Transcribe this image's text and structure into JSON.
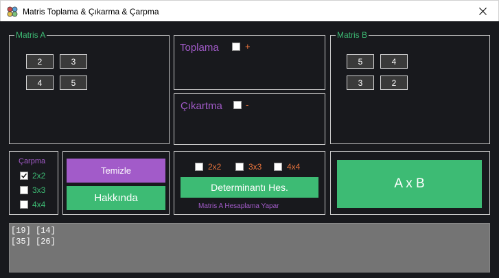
{
  "window": {
    "title": "Matris Toplama & Çıkarma & Çarpma",
    "icon": "app-icon",
    "close_icon": "close-icon"
  },
  "matrix_a": {
    "legend": "Matris A",
    "cells": [
      "2",
      "3",
      "4",
      "5"
    ]
  },
  "matrix_b": {
    "legend": "Matris B",
    "cells": [
      "5",
      "4",
      "3",
      "2"
    ]
  },
  "toplama": {
    "label": "Toplama",
    "sign": "+",
    "checked": false
  },
  "cikartma": {
    "label": "Çıkartma",
    "sign": "-",
    "checked": false
  },
  "carpma": {
    "title": "Çarpma",
    "options": [
      {
        "label": "2x2",
        "checked": true
      },
      {
        "label": "3x3",
        "checked": false
      },
      {
        "label": "4x4",
        "checked": false
      }
    ]
  },
  "buttons": {
    "temizle": "Temizle",
    "hakkinda": "Hakkında",
    "determinant": "Determinantı Hes.",
    "multiply": "A x B"
  },
  "determinant": {
    "options": [
      {
        "label": "2x2",
        "checked": false
      },
      {
        "label": "3x3",
        "checked": false
      },
      {
        "label": "4x4",
        "checked": false
      }
    ],
    "note": "Matris A Hesaplama Yapar"
  },
  "output": {
    "lines": [
      "[19] [14]",
      "[35] [26]"
    ]
  },
  "colors": {
    "background": "#18191d",
    "green": "#3dbb74",
    "purple": "#a25bc9",
    "orange": "#e8733c",
    "output_bg": "#747474"
  }
}
